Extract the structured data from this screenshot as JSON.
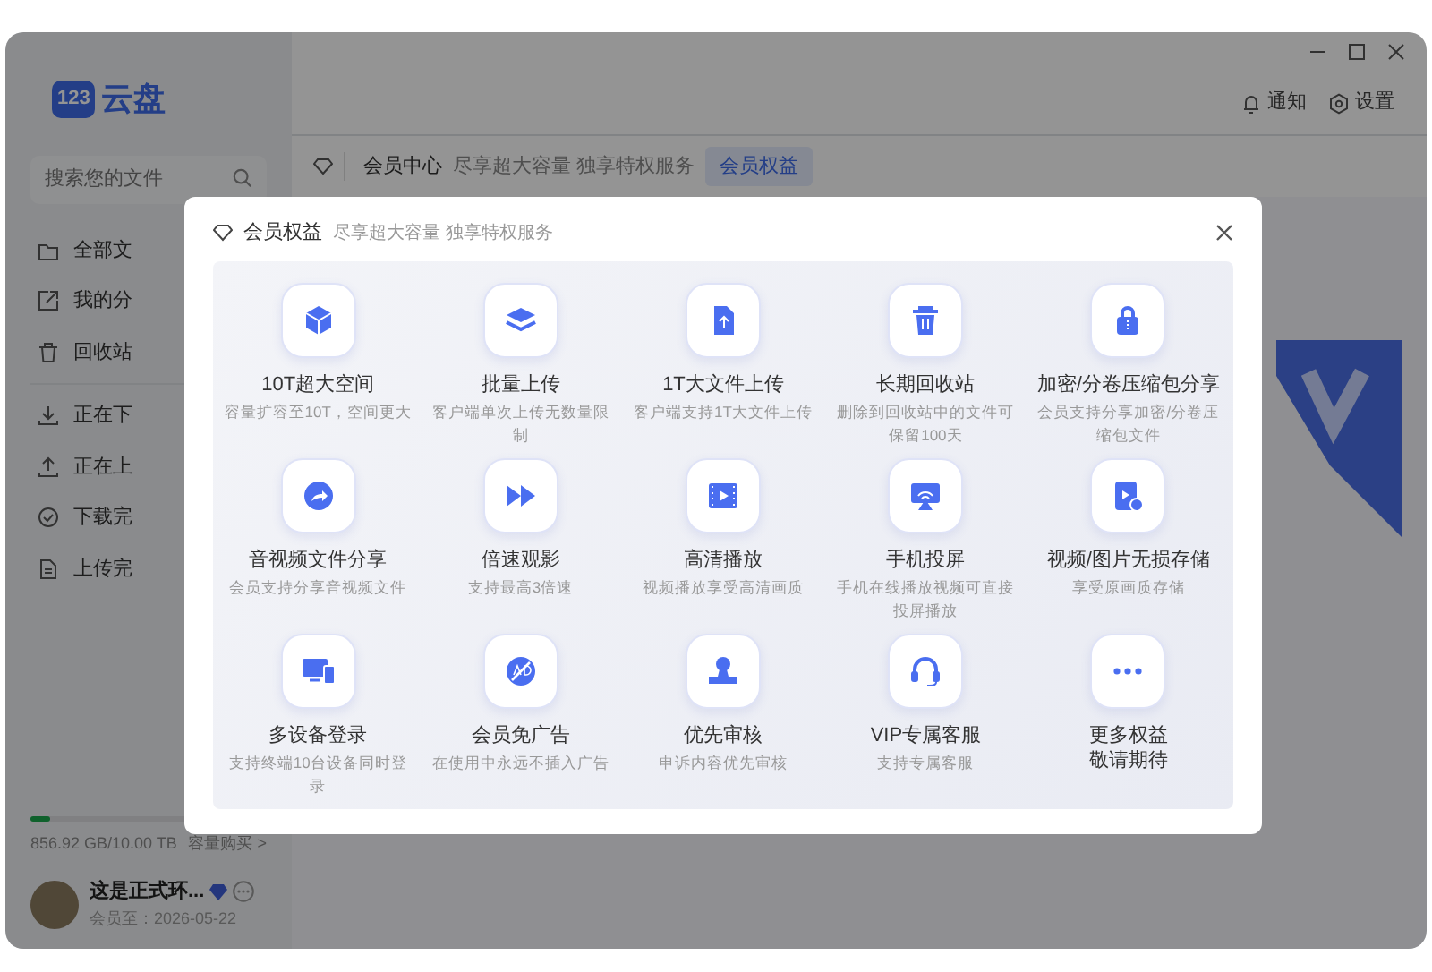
{
  "app": {
    "logo_badge": "123",
    "logo_text": "云盘",
    "search": {
      "placeholder": "搜索您的文件"
    }
  },
  "sidebar": {
    "items": [
      {
        "label": "全部文"
      },
      {
        "label": "我的分"
      },
      {
        "label": "回收站"
      },
      {
        "label": "正在下"
      },
      {
        "label": "正在上"
      },
      {
        "label": "下载完"
      },
      {
        "label": "上传完"
      }
    ],
    "storage": {
      "level": 0.085,
      "text": "856.92 GB/10.00 TB",
      "buy": "容量购买 >"
    },
    "user": {
      "name": "这是正式环...",
      "expiry": "会员至：2026-05-22"
    }
  },
  "topbar": {
    "notify": "通知",
    "settings": "设置"
  },
  "breadcrumb": {
    "title": "会员中心",
    "subtitle": "尽享超大容量 独享特权服务",
    "tab": "会员权益"
  },
  "modal": {
    "title": "会员权益",
    "subtitle": "尽享超大容量 独享特权服务",
    "features": [
      {
        "title": "10T超大空间",
        "desc": "容量扩容至10T，空间更大"
      },
      {
        "title": "批量上传",
        "desc": "客户端单次上传无数量限制"
      },
      {
        "title": "1T大文件上传",
        "desc": "客户端支持1T大文件上传"
      },
      {
        "title": "长期回收站",
        "desc": "删除到回收站中的文件可保留100天"
      },
      {
        "title": "加密/分卷压缩包分享",
        "desc": "会员支持分享加密/分卷压缩包文件"
      },
      {
        "title": "音视频文件分享",
        "desc": "会员支持分享音视频文件"
      },
      {
        "title": "倍速观影",
        "desc": "支持最高3倍速"
      },
      {
        "title": "高清播放",
        "desc": "视频播放享受高清画质"
      },
      {
        "title": "手机投屏",
        "desc": "手机在线播放视频可直接投屏播放"
      },
      {
        "title": "视频/图片无损存储",
        "desc": "享受原画质存储"
      },
      {
        "title": "多设备登录",
        "desc": "支持终端10台设备同时登录"
      },
      {
        "title": "会员免广告",
        "desc": "在使用中永远不插入广告"
      },
      {
        "title": "优先审核",
        "desc": "申诉内容优先审核"
      },
      {
        "title": "VIP专属客服",
        "desc": "支持专属客服"
      },
      {
        "title": "更多权益",
        "title_2": "敬请期待"
      }
    ]
  }
}
